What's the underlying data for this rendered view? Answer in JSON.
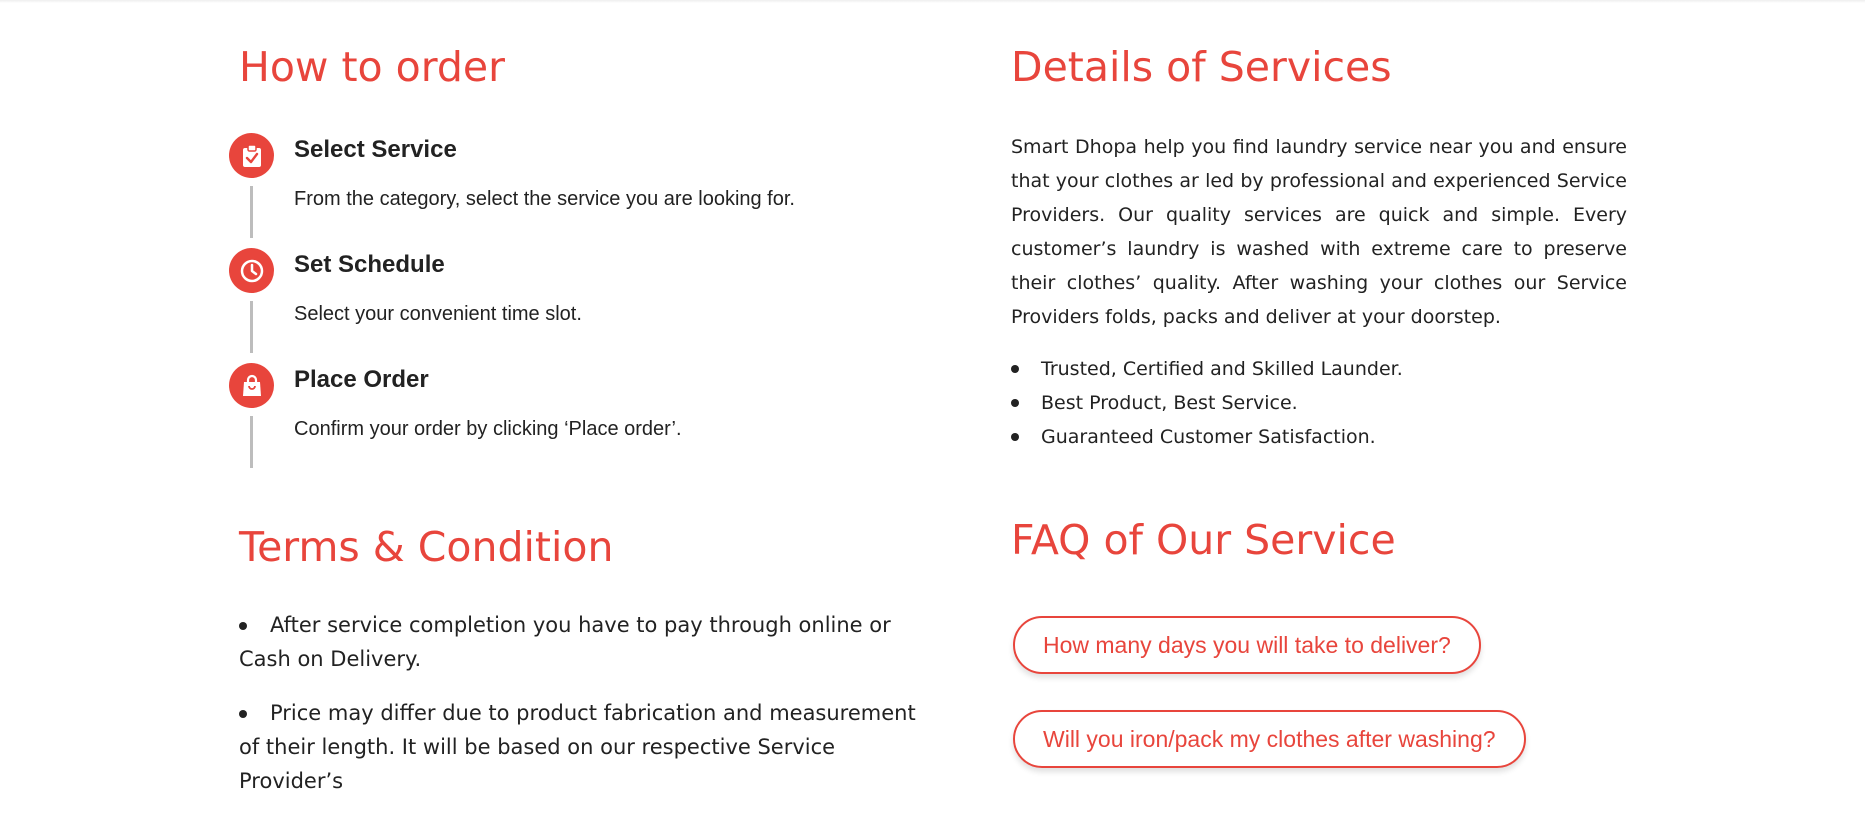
{
  "how_to_order": {
    "title": "How to order",
    "steps": [
      {
        "title": "Select Service",
        "desc": "From the category, select the service you are looking for.",
        "icon": "clipboard-check-icon"
      },
      {
        "title": "Set Schedule",
        "desc": "Select your convenient time slot.",
        "icon": "clock-icon"
      },
      {
        "title": "Place Order",
        "desc": "Confirm your order by clicking ‘Place order’.",
        "icon": "shopping-bag-icon"
      }
    ]
  },
  "details": {
    "title": "Details of Services",
    "paragraph": "Smart Dhopa help you find laundry service near you and ensure that your clothes ar led by professional and experienced Service Providers. Our quality services are quick and simple. Every customer’s laundry is washed with extreme care to preserve their clothes’ quality. After washing your clothes our Service Providers folds, packs and deliver at your doorstep.",
    "bullets": [
      "Trusted, Certified and Skilled Launder.",
      "Best Product, Best Service.",
      "Guaranteed Customer Satisfaction."
    ]
  },
  "terms": {
    "title": "Terms & Condition",
    "bullets": [
      "After service completion you have to pay through online or Cash on Delivery.",
      "Price may differ due to product fabrication and measurement of their length. It will be based on our respective Service Provider’s"
    ]
  },
  "faq": {
    "title": "FAQ of Our Service",
    "questions": [
      "How many days you will take to deliver?",
      "Will you iron/pack my clothes after washing?"
    ]
  },
  "colors": {
    "accent": "#e8453c",
    "text": "#222222",
    "timeline": "#bdbdbd"
  }
}
